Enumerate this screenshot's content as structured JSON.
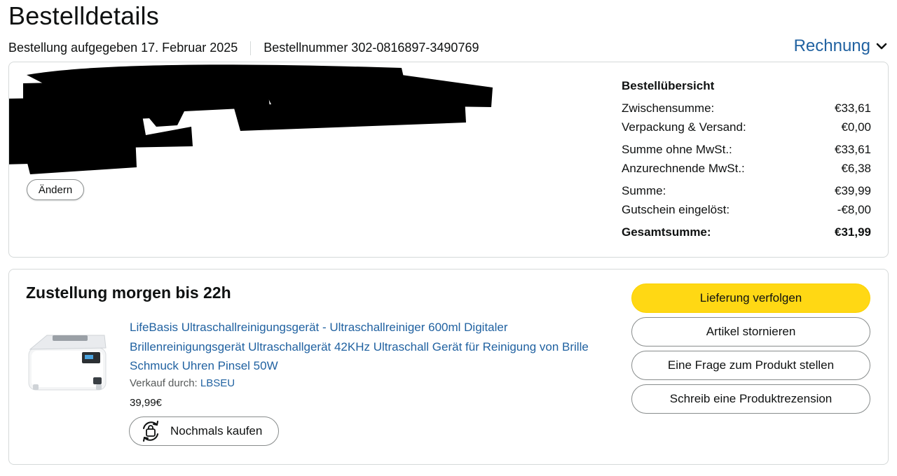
{
  "header": {
    "title": "Bestelldetails",
    "order_placed": "Bestellung aufgegeben 17. Februar 2025",
    "order_number": "Bestellnummer 302-0816897-3490769",
    "invoice_label": "Rechnung"
  },
  "address_card": {
    "change_label": "Ändern"
  },
  "summary": {
    "title": "Bestellübersicht",
    "rows": [
      {
        "label": "Zwischensumme:",
        "value": "€33,61"
      },
      {
        "label": "Verpackung & Versand:",
        "value": "€0,00"
      },
      {
        "label": "Summe ohne MwSt.:",
        "value": "€33,61"
      },
      {
        "label": "Anzurechnende MwSt.:",
        "value": "€6,38"
      },
      {
        "label": "Summe:",
        "value": "€39,99"
      },
      {
        "label": "Gutschein eingelöst:",
        "value": "-€8,00"
      },
      {
        "label": "Gesamtsumme:",
        "value": "€31,99"
      }
    ]
  },
  "shipment": {
    "delivery_title": "Zustellung morgen bis 22h",
    "product_title": "LifeBasis Ultraschallreinigungsgerät - Ultraschallreiniger 600ml Digitaler Brillenreinigungsgerät Ultraschallgerät 42KHz Ultraschall Gerät für Reinigung von Brille Schmuck Uhren Pinsel 50W",
    "seller_prefix": "Verkauf durch: ",
    "seller_name": "LBSEU",
    "price": "39,99€",
    "buy_again_label": "Nochmals kaufen",
    "actions": {
      "track": "Lieferung verfolgen",
      "cancel": "Artikel stornieren",
      "question": "Eine Frage zum Produkt stellen",
      "review": "Schreib eine Produktrezension"
    }
  },
  "colors": {
    "link": "#2162a1",
    "primary_button": "#ffd814",
    "border": "#d5d9d9"
  }
}
